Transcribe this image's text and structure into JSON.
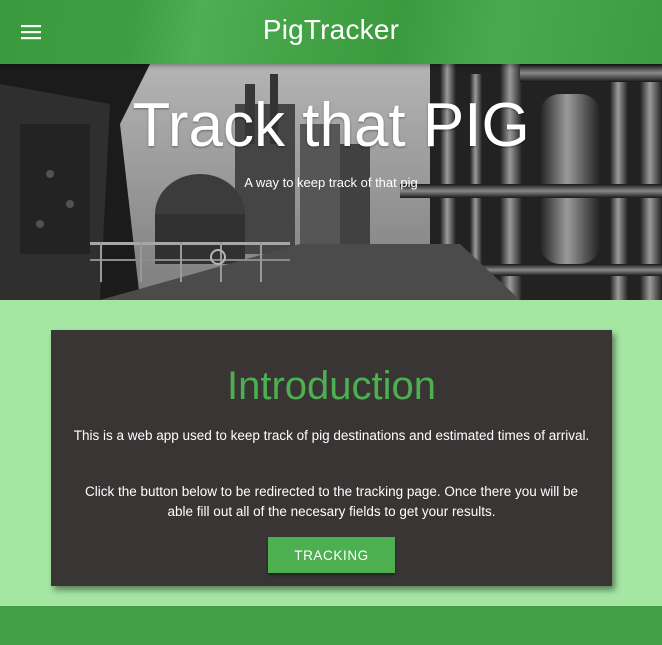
{
  "appbar": {
    "title": "PigTracker",
    "menu_icon": "hamburger-menu-icon",
    "color": "#43a047"
  },
  "hero": {
    "title": "Track that PIG",
    "subtitle": "A way to keep track of that pig"
  },
  "intro": {
    "title": "Introduction",
    "paragraph1": "This is a web app used to keep track of pig destinations and estimated times of arrival.",
    "paragraph2": "Click the button below to be redirected to the tracking page. Once there you will be able fill out all of the necesary fields to get your results.",
    "button_label": "TRACKING",
    "title_color": "#4caf50",
    "card_color": "#3a3535"
  },
  "colors": {
    "page_background": "#a5e6a3",
    "footer": "#43a047"
  }
}
